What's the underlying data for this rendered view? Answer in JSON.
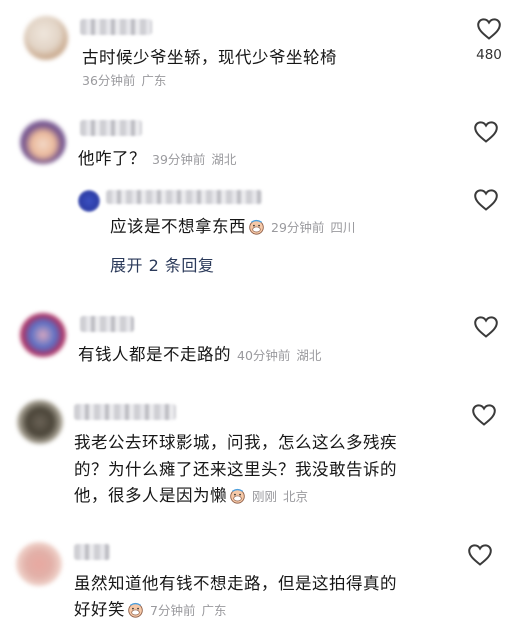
{
  "comments": [
    {
      "text": "古时候少爷坐轿，现代少爷坐轮椅",
      "time": "36分钟前",
      "location": "广东",
      "likes": "480"
    },
    {
      "text": "他咋了？",
      "time": "39分钟前",
      "location": "湖北",
      "reply": {
        "text": "应该是不想拿东西",
        "time": "29分钟前",
        "location": "四川"
      },
      "expand_label": "展开 2 条回复"
    },
    {
      "text": "有钱人都是不走路的",
      "time": "40分钟前",
      "location": "湖北"
    },
    {
      "text_line1": "我老公去环球影城，问我，怎么这么多残疾",
      "text_line2": "的？为什么瘫了还来这里头？我没敢告诉的",
      "text_line3": "他，很多人是因为懒",
      "time": "刚刚",
      "location": "北京"
    },
    {
      "text_line1": "虽然知道他有钱不想走路，但是这拍得真的",
      "text_line2": "好好笑",
      "time": "7分钟前",
      "location": "广东"
    }
  ],
  "icons": {
    "like": "heart-outline-icon",
    "emoji": "face-emoji-icon"
  },
  "colors": {
    "meta": "#9a9a9e",
    "expand": "#2b3a5a",
    "text": "#161616"
  }
}
